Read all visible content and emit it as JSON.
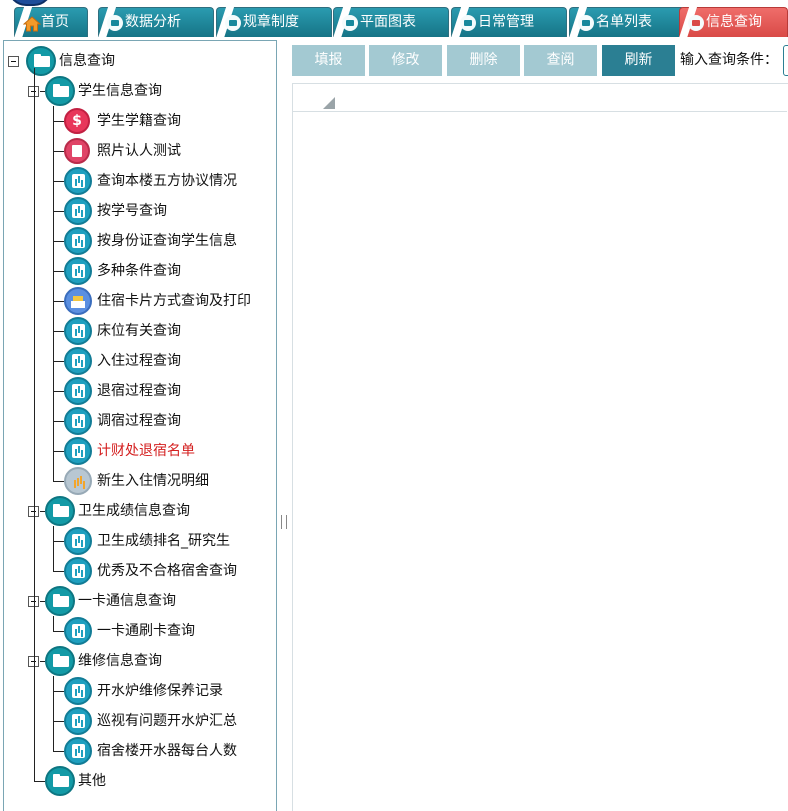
{
  "tabs": [
    {
      "label": "首页",
      "icon": "home-icon",
      "active": false
    },
    {
      "label": "数据分析",
      "icon": "folder-icon",
      "active": false
    },
    {
      "label": "规章制度",
      "icon": "folder-icon",
      "active": false
    },
    {
      "label": "平面图表",
      "icon": "folder-icon",
      "active": false
    },
    {
      "label": "日常管理",
      "icon": "folder-icon",
      "active": false
    },
    {
      "label": "名单列表",
      "icon": "folder-icon",
      "active": false
    },
    {
      "label": "信息查询",
      "icon": "folder-icon",
      "active": true
    }
  ],
  "tree": {
    "root": {
      "label": "信息查询"
    },
    "groups": [
      {
        "label": "学生信息查询",
        "items": [
          {
            "label": "学生学籍查询",
            "icon": "dollar-icon"
          },
          {
            "label": "照片认人测试",
            "icon": "photo-icon"
          },
          {
            "label": "查询本楼五方协议情况",
            "icon": "chart-icon"
          },
          {
            "label": "按学号查询",
            "icon": "chart-icon"
          },
          {
            "label": "按身份证查询学生信息",
            "icon": "chart-icon"
          },
          {
            "label": "多种条件查询",
            "icon": "chart-icon"
          },
          {
            "label": "住宿卡片方式查询及打印",
            "icon": "print-icon"
          },
          {
            "label": "床位有关查询",
            "icon": "chart-icon"
          },
          {
            "label": "入住过程查询",
            "icon": "chart-icon"
          },
          {
            "label": "退宿过程查询",
            "icon": "chart-icon"
          },
          {
            "label": "调宿过程查询",
            "icon": "chart-icon"
          },
          {
            "label": "计财处退宿名单",
            "icon": "chart-icon",
            "highlight_color": "#d42020"
          },
          {
            "label": "新生入住情况明细",
            "icon": "bar-chart-icon"
          }
        ]
      },
      {
        "label": "卫生成绩信息查询",
        "items": [
          {
            "label": "卫生成绩排名_研究生",
            "icon": "chart-icon"
          },
          {
            "label": "优秀及不合格宿舍查询",
            "icon": "chart-icon"
          }
        ]
      },
      {
        "label": "一卡通信息查询",
        "items": [
          {
            "label": "一卡通刷卡查询",
            "icon": "chart-icon"
          }
        ]
      },
      {
        "label": "维修信息查询",
        "items": [
          {
            "label": "开水炉维修保养记录",
            "icon": "chart-icon"
          },
          {
            "label": "巡视有问题开水炉汇总",
            "icon": "chart-icon"
          },
          {
            "label": "宿舍楼开水器每台人数",
            "icon": "chart-icon"
          }
        ]
      },
      {
        "label": "其他",
        "items": []
      }
    ]
  },
  "toolbar": {
    "buttons": [
      {
        "label": "填报",
        "enabled": false
      },
      {
        "label": "修改",
        "enabled": false
      },
      {
        "label": "删除",
        "enabled": false
      },
      {
        "label": "查阅",
        "enabled": false
      },
      {
        "label": "刷新",
        "enabled": true
      }
    ],
    "query_label": "输入查询条件：",
    "query_value": ""
  },
  "colors": {
    "tab": "#1f8ca0",
    "tab_active": "#e25a57",
    "button_disabled": "#a3c9d2",
    "button_primary": "#2b7f93",
    "folder_icon": "#139aa6",
    "red_text": "#d42020"
  }
}
